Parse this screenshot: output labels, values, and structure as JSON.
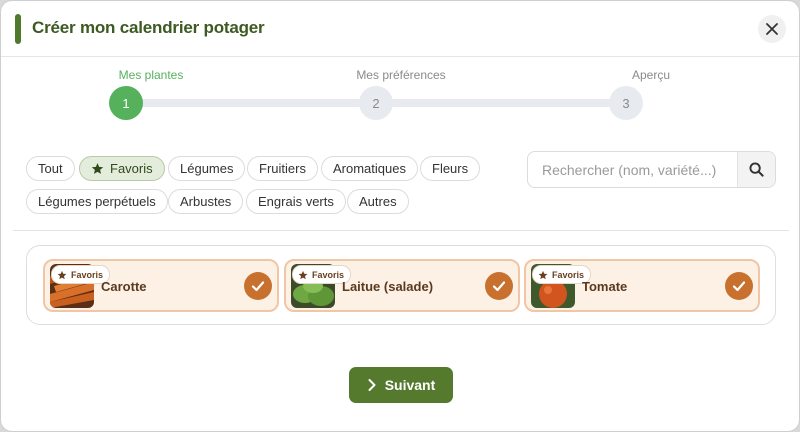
{
  "dialog": {
    "title": "Créer mon calendrier potager",
    "close_icon": "close-icon"
  },
  "steps": [
    {
      "number": "1",
      "label": "Mes plantes",
      "active": true
    },
    {
      "number": "2",
      "label": "Mes préférences",
      "active": false
    },
    {
      "number": "3",
      "label": "Aperçu",
      "active": false
    }
  ],
  "filters": {
    "chips": [
      "Tout",
      "Favoris",
      "Légumes",
      "Fruitiers",
      "Aromatiques",
      "Fleurs",
      "Légumes perpétuels",
      "Arbustes",
      "Engrais verts",
      "Autres"
    ],
    "active": "Favoris",
    "active_icon": "star-icon"
  },
  "search": {
    "placeholder": "Rechercher (nom, variété...)",
    "value": "",
    "icon": "search-icon"
  },
  "selected_plants": [
    {
      "name": "Carotte",
      "badge": "Favoris",
      "selected": true,
      "image": "carrot-photo"
    },
    {
      "name": "Laitue (salade)",
      "badge": "Favoris",
      "selected": true,
      "image": "lettuce-photo"
    },
    {
      "name": "Tomate",
      "badge": "Favoris",
      "selected": true,
      "image": "tomato-photo"
    }
  ],
  "footer": {
    "next_label": "Suivant",
    "next_icon": "chevron-right-icon"
  },
  "colors": {
    "brand_green": "#557a2e",
    "step_active": "#55b15c",
    "card_accent": "#c8712e"
  }
}
